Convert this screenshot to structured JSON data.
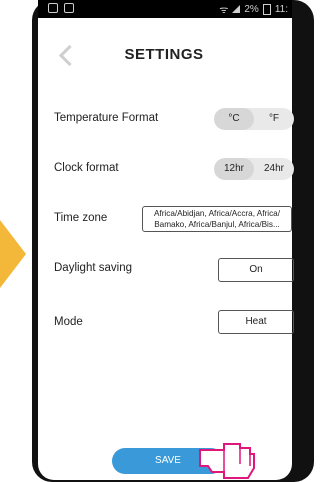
{
  "status_bar": {
    "time": "11:",
    "battery": "2%"
  },
  "header": {
    "title": "SETTINGS"
  },
  "settings": {
    "temperature": {
      "label": "Temperature Format",
      "options": [
        "°C",
        "°F"
      ],
      "selected": "°C"
    },
    "clock": {
      "label": "Clock format",
      "options": [
        "12hr",
        "24hr"
      ],
      "selected": "12hr"
    },
    "timezone": {
      "label": "Time zone",
      "value_line1": "Africa/Abidjan, Africa/Accra, Africa/",
      "value_line2": "Bamako, Africa/Banjul, Africa/Bis..."
    },
    "daylight": {
      "label": "Daylight saving",
      "value": "On"
    },
    "mode": {
      "label": "Mode",
      "value": "Heat"
    }
  },
  "footer": {
    "save_label": "SAVE"
  },
  "colors": {
    "accent": "#3a9ad9",
    "arrow": "#f3b73a",
    "hand": "#e0167b"
  }
}
